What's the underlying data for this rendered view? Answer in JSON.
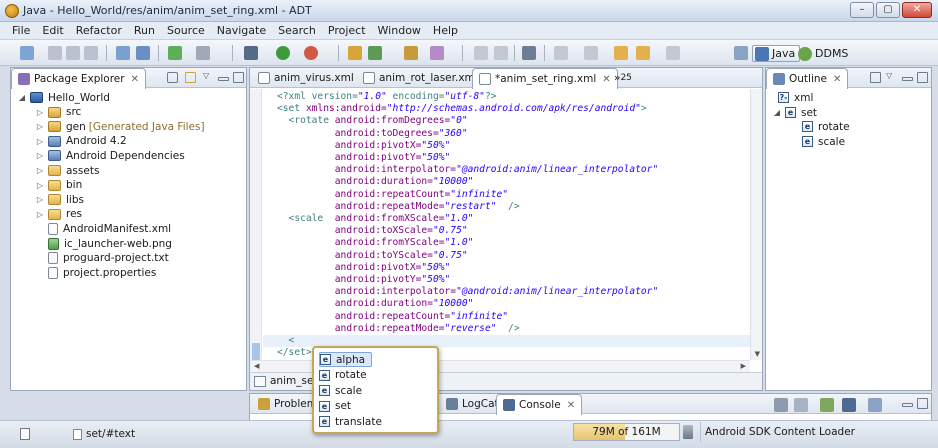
{
  "window": {
    "title": "Java - Hello_World/res/anim/anim_set_ring.xml - ADT",
    "controls": [
      "–",
      "▢",
      "✕"
    ]
  },
  "menu": [
    "File",
    "Edit",
    "Refactor",
    "Run",
    "Source",
    "Navigate",
    "Search",
    "Project",
    "Window",
    "Help"
  ],
  "perspectives": {
    "java": "Java",
    "ddms": "DDMS"
  },
  "package_explorer": {
    "title": "Package Explorer",
    "items": [
      {
        "label": "Hello_World",
        "expanded": true,
        "icon": "project-icon"
      },
      {
        "label": "src",
        "icon": "source-folder-icon"
      },
      {
        "label": "gen",
        "note": "[Generated Java Files]",
        "icon": "source-folder-icon"
      },
      {
        "label": "Android 4.2",
        "icon": "library-icon"
      },
      {
        "label": "Android Dependencies",
        "icon": "library-icon"
      },
      {
        "label": "assets",
        "icon": "folder-icon"
      },
      {
        "label": "bin",
        "icon": "folder-icon"
      },
      {
        "label": "libs",
        "icon": "folder-icon"
      },
      {
        "label": "res",
        "icon": "folder-icon"
      },
      {
        "label": "AndroidManifest.xml",
        "icon": "xml-file-icon"
      },
      {
        "label": "ic_launcher-web.png",
        "icon": "image-file-icon"
      },
      {
        "label": "proguard-project.txt",
        "icon": "text-file-icon"
      },
      {
        "label": "project.properties",
        "icon": "text-file-icon"
      }
    ]
  },
  "editor": {
    "tabs": [
      {
        "label": "anim_virus.xml",
        "active": false
      },
      {
        "label": "anim_rot_laser.xml",
        "active": false
      },
      {
        "label": "*anim_set_ring.xml",
        "active": true
      }
    ],
    "overflow": "»",
    "overflow_count": "25",
    "lines": [
      [
        {
          "t": "<?xml version=",
          "c": "pi"
        },
        {
          "t": "\"1.0\"",
          "c": "str"
        },
        {
          "t": " encoding=",
          "c": "pi"
        },
        {
          "t": "\"utf-8\"",
          "c": "str"
        },
        {
          "t": "?>",
          "c": "pi"
        }
      ],
      [
        {
          "t": "<set ",
          "c": "tag"
        },
        {
          "t": "xmlns:android=",
          "c": "attr"
        },
        {
          "t": "\"http://schemas.android.com/apk/res/android\"",
          "c": "str"
        },
        {
          "t": ">",
          "c": "tag"
        }
      ],
      [
        {
          "t": "  <rotate ",
          "c": "tag"
        },
        {
          "t": "android:fromDegrees=",
          "c": "attr"
        },
        {
          "t": "\"0\"",
          "c": "str"
        }
      ],
      [
        {
          "t": "          ",
          "c": "tag"
        },
        {
          "t": "android:toDegrees=",
          "c": "attr"
        },
        {
          "t": "\"360\"",
          "c": "str"
        }
      ],
      [
        {
          "t": "          ",
          "c": "tag"
        },
        {
          "t": "android:pivotX=",
          "c": "attr"
        },
        {
          "t": "\"50%\"",
          "c": "str"
        }
      ],
      [
        {
          "t": "          ",
          "c": "tag"
        },
        {
          "t": "android:pivotY=",
          "c": "attr"
        },
        {
          "t": "\"50%\"",
          "c": "str"
        }
      ],
      [
        {
          "t": "          ",
          "c": "tag"
        },
        {
          "t": "android:interpolator=",
          "c": "attr"
        },
        {
          "t": "\"@android:anim/linear_interpolator\"",
          "c": "str"
        }
      ],
      [
        {
          "t": "          ",
          "c": "tag"
        },
        {
          "t": "android:duration=",
          "c": "attr"
        },
        {
          "t": "\"10000\"",
          "c": "str"
        }
      ],
      [
        {
          "t": "          ",
          "c": "tag"
        },
        {
          "t": "android:repeatCount=",
          "c": "attr"
        },
        {
          "t": "\"infinite\"",
          "c": "str"
        }
      ],
      [
        {
          "t": "          ",
          "c": "tag"
        },
        {
          "t": "android:repeatMode=",
          "c": "attr"
        },
        {
          "t": "\"restart\"",
          "c": "str"
        },
        {
          "t": "  />",
          "c": "tag"
        }
      ],
      [
        {
          "t": "  <scale  ",
          "c": "tag"
        },
        {
          "t": "android:fromXScale=",
          "c": "attr"
        },
        {
          "t": "\"1.0\"",
          "c": "str"
        }
      ],
      [
        {
          "t": "          ",
          "c": "tag"
        },
        {
          "t": "android:toXScale=",
          "c": "attr"
        },
        {
          "t": "\"0.75\"",
          "c": "str"
        }
      ],
      [
        {
          "t": "          ",
          "c": "tag"
        },
        {
          "t": "android:fromYScale=",
          "c": "attr"
        },
        {
          "t": "\"1.0\"",
          "c": "str"
        }
      ],
      [
        {
          "t": "          ",
          "c": "tag"
        },
        {
          "t": "android:toYScale=",
          "c": "attr"
        },
        {
          "t": "\"0.75\"",
          "c": "str"
        }
      ],
      [
        {
          "t": "          ",
          "c": "tag"
        },
        {
          "t": "android:pivotX=",
          "c": "attr"
        },
        {
          "t": "\"50%\"",
          "c": "str"
        }
      ],
      [
        {
          "t": "          ",
          "c": "tag"
        },
        {
          "t": "android:pivotY=",
          "c": "attr"
        },
        {
          "t": "\"50%\"",
          "c": "str"
        }
      ],
      [
        {
          "t": "          ",
          "c": "tag"
        },
        {
          "t": "android:interpolator=",
          "c": "attr"
        },
        {
          "t": "\"@android:anim/linear_interpolator\"",
          "c": "str"
        }
      ],
      [
        {
          "t": "          ",
          "c": "tag"
        },
        {
          "t": "android:duration=",
          "c": "attr"
        },
        {
          "t": "\"10000\"",
          "c": "str"
        }
      ],
      [
        {
          "t": "          ",
          "c": "tag"
        },
        {
          "t": "android:repeatCount=",
          "c": "attr"
        },
        {
          "t": "\"infinite\"",
          "c": "str"
        }
      ],
      [
        {
          "t": "          ",
          "c": "tag"
        },
        {
          "t": "android:repeatMode=",
          "c": "attr"
        },
        {
          "t": "\"reverse\"",
          "c": "str"
        },
        {
          "t": "  />",
          "c": "tag"
        }
      ],
      [
        {
          "t": "  <",
          "c": "tag"
        }
      ],
      [
        {
          "t": "</set>",
          "c": "tag"
        }
      ]
    ],
    "current_line": 20,
    "breadcrumb": "anim_set_"
  },
  "autocomplete": {
    "items": [
      "alpha",
      "rotate",
      "scale",
      "set",
      "translate"
    ],
    "selected": 0,
    "icon_letter": "e"
  },
  "outline": {
    "title": "Outline",
    "items": [
      {
        "label": "xml",
        "icon": "?-"
      },
      {
        "label": "set",
        "icon": "e"
      },
      {
        "label": "rotate",
        "icon": "e"
      },
      {
        "label": "scale",
        "icon": "e"
      }
    ]
  },
  "bottom_panel": {
    "tabs": [
      "Problems",
      "LogCat",
      "Console"
    ]
  },
  "status": {
    "path": "set/#text",
    "heap": "79M of 161M",
    "heap_used_fraction": 0.49,
    "task": "Android SDK Content Loader"
  }
}
